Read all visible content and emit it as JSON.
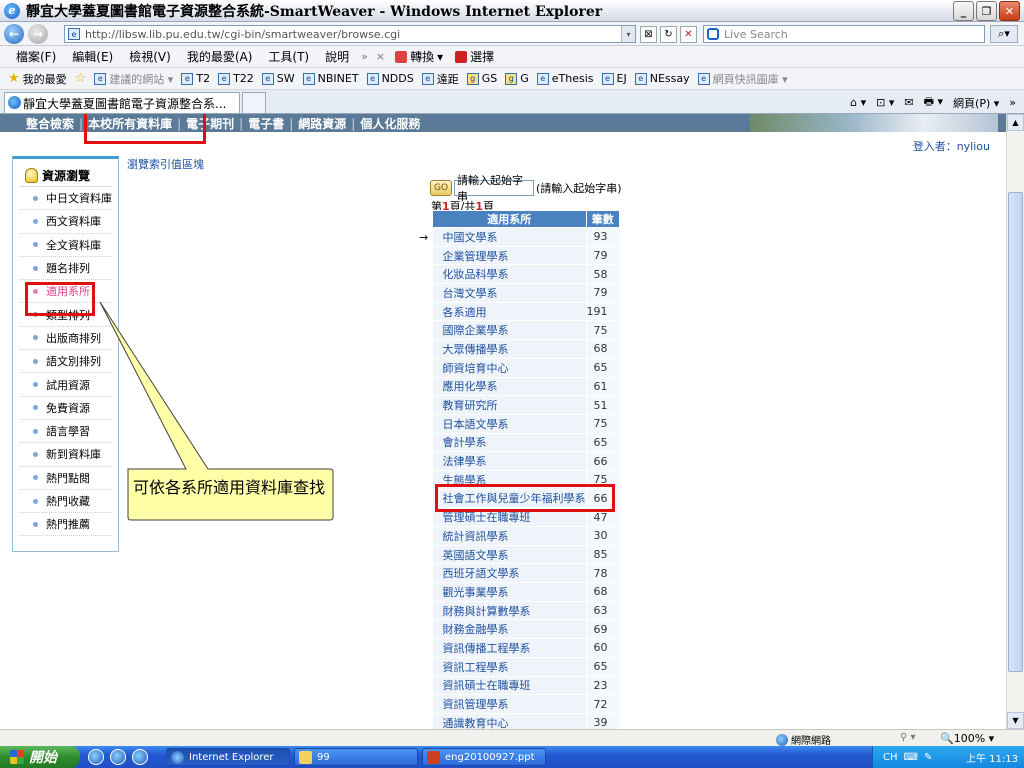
{
  "window": {
    "title": "靜宜大學蓋夏圖書館電子資源整合系統-SmartWeaver - Windows Internet Explorer",
    "min": "_",
    "max": "❐",
    "close": "✕"
  },
  "address": {
    "url": "http://libsw.lib.pu.edu.tw/cgi-bin/smartweaver/browse.cgi",
    "search_placeholder": "Live Search"
  },
  "menu": {
    "items": [
      "檔案(F)",
      "編輯(E)",
      "檢視(V)",
      "我的最愛(A)",
      "工具(T)",
      "說明"
    ],
    "more": "»",
    "close_x": "×",
    "convert": "轉換",
    "select": "選擇"
  },
  "favorites": {
    "label": "我的最愛",
    "items": [
      "建議的網站 ▾",
      "T2",
      "T22",
      "SW",
      "NBINET",
      "NDDS",
      "遠距",
      "GS",
      "G",
      "eThesis",
      "EJ",
      "NEssay",
      "網頁快訊圖庫 ▾"
    ]
  },
  "tabs": {
    "active": "靜宜大學蓋夏圖書館電子資源整合系...",
    "tools": [
      "⌂ ▾",
      "⊡ ▾",
      "✉",
      "🖶 ▾",
      "網頁(P) ▾"
    ],
    "more": "»"
  },
  "site": {
    "nav": [
      "整合檢索",
      "本校所有資料庫",
      "電子期刊",
      "電子書",
      "網路資源",
      "個人化服務"
    ],
    "login": "登入者：nyliou",
    "browse_hint": "瀏覽索引值區塊"
  },
  "left_panel": {
    "header": "資源瀏覽",
    "items": [
      "中日文資料庫",
      "西文資料庫",
      "全文資料庫",
      "題名排列",
      "適用系所",
      "類型排列",
      "出版商排列",
      "語文別排列",
      "試用資源",
      "免費資源",
      "語言學習",
      "新到資料庫",
      "熱門點閱",
      "熱門收藏",
      "熱門推薦"
    ],
    "active_index": 4
  },
  "search": {
    "go": "GO",
    "input_value": "請輸入起始字串",
    "hint": "(請輸入起始字串)",
    "page_prefix": "第",
    "page_current": "1",
    "page_mid": "頁/共",
    "page_total": "1",
    "page_suffix": "頁"
  },
  "table": {
    "headers": [
      "適用系所",
      "筆數"
    ],
    "rows": [
      {
        "dept": "中國文學系",
        "count": "93"
      },
      {
        "dept": "企業管理學系",
        "count": "79"
      },
      {
        "dept": "化妝品科學系",
        "count": "58"
      },
      {
        "dept": "台灣文學系",
        "count": "79"
      },
      {
        "dept": "各系適用",
        "count": "191"
      },
      {
        "dept": "國際企業學系",
        "count": "75"
      },
      {
        "dept": "大眾傳播學系",
        "count": "68"
      },
      {
        "dept": "師資培育中心",
        "count": "65"
      },
      {
        "dept": "應用化學系",
        "count": "61"
      },
      {
        "dept": "教育研究所",
        "count": "51"
      },
      {
        "dept": "日本語文學系",
        "count": "75"
      },
      {
        "dept": "會計學系",
        "count": "65"
      },
      {
        "dept": "法律學系",
        "count": "66"
      },
      {
        "dept": "生態學系",
        "count": "75"
      },
      {
        "dept": "社會工作與兒童少年福利學系",
        "count": "66"
      },
      {
        "dept": "管理碩士在職專班",
        "count": "47"
      },
      {
        "dept": "統計資訊學系",
        "count": "30"
      },
      {
        "dept": "英國語文學系",
        "count": "85"
      },
      {
        "dept": "西班牙語文學系",
        "count": "78"
      },
      {
        "dept": "觀光事業學系",
        "count": "68"
      },
      {
        "dept": "財務與計算數學系",
        "count": "63"
      },
      {
        "dept": "財務金融學系",
        "count": "69"
      },
      {
        "dept": "資訊傳播工程學系",
        "count": "60"
      },
      {
        "dept": "資訊工程學系",
        "count": "65"
      },
      {
        "dept": "資訊碩士在職專班",
        "count": "23"
      },
      {
        "dept": "資訊管理學系",
        "count": "72"
      },
      {
        "dept": "通識教育中心",
        "count": "39"
      }
    ],
    "row_marker": "→"
  },
  "callout": {
    "text": "可依各系所適用資料庫查找"
  },
  "status": {
    "zone": "網際網路",
    "zoom": "100%",
    "lock_icons": "⚲ ▾"
  },
  "taskbar": {
    "start": "開始",
    "tasks": [
      "Internet Explorer",
      "99",
      "eng20100927.ppt"
    ],
    "tray_lang": "CH",
    "clock": "上午 11:13"
  },
  "colors": {
    "nav_bg": "#5A7A98",
    "table_header": "#4A82C0",
    "highlight": "#E01010",
    "callout_fill": "#FFFFA8"
  }
}
